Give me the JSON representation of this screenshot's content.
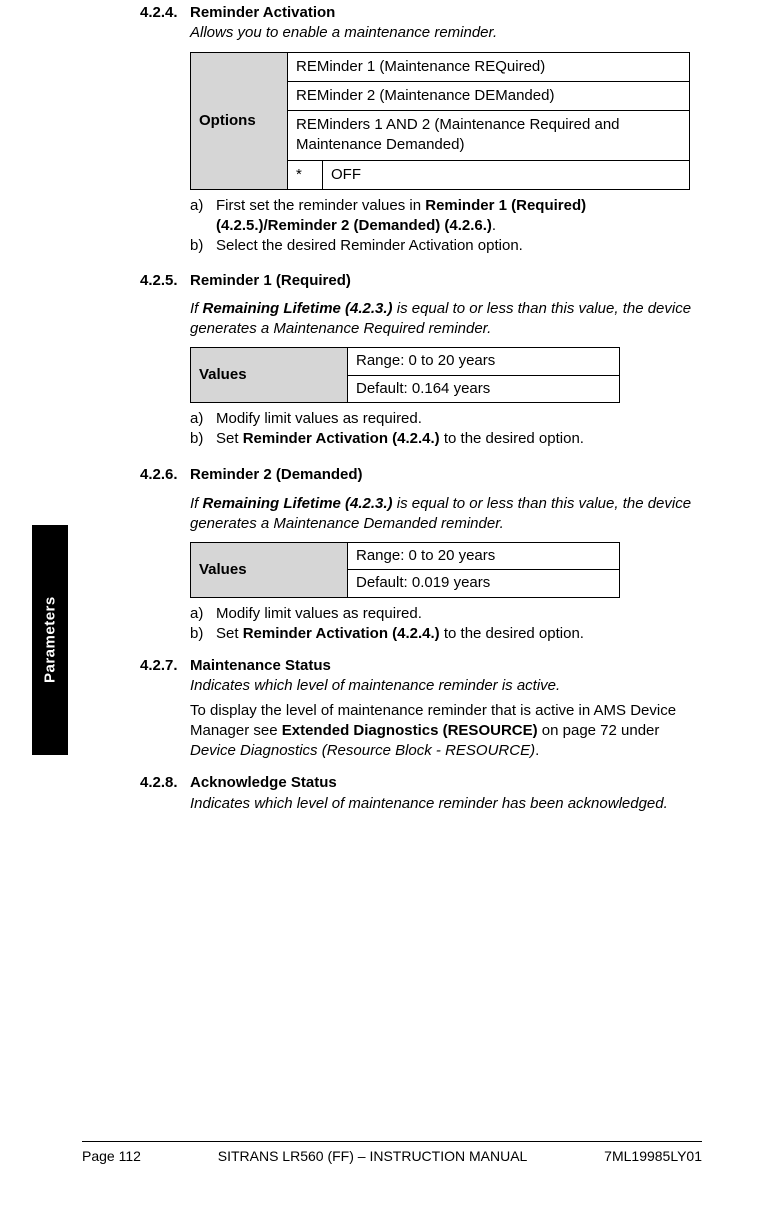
{
  "sidetab": "Parameters",
  "sections": {
    "s424": {
      "num": "4.2.4.",
      "title": "Reminder Activation",
      "desc": "Allows you to enable a maintenance reminder.",
      "optionsLabel": "Options",
      "opt1": "REMinder 1 (Maintenance REQuired)",
      "opt2": "REMinder 2 (Maintenance DEManded)",
      "opt3": "REMinders 1 AND 2 (Maintenance Required and Maintenance Demanded)",
      "star": "*",
      "opt4": "OFF",
      "a_pre": "First set the reminder values in ",
      "a_bold": "Reminder 1 (Required) (4.2.5.)/Reminder 2 (Demanded) (4.2.6.)",
      "a_post": ".",
      "b": "Select the desired Reminder Activation option."
    },
    "s425": {
      "num": "4.2.5.",
      "title": "Reminder 1 (Required)",
      "desc_pre": "If ",
      "desc_bold": "Remaining Lifetime (4.2.3.)",
      "desc_post": " is equal to or less than this value, the device generates a Maintenance Required reminder.",
      "valuesLabel": "Values",
      "range": "Range: 0 to 20 years",
      "default": "Default: 0.164 years",
      "a": "Modify limit values as required.",
      "b_pre": "Set ",
      "b_bold": "Reminder Activation (4.2.4.)",
      "b_post": " to the desired option."
    },
    "s426": {
      "num": "4.2.6.",
      "title": "Reminder 2 (Demanded)",
      "desc_pre": "If ",
      "desc_bold": "Remaining Lifetime (4.2.3.)",
      "desc_post": " is equal to or less than this value, the device generates a Maintenance Demanded reminder.",
      "valuesLabel": "Values",
      "range": "Range: 0 to 20 years",
      "default": "Default: 0.019 years",
      "a": "Modify limit values as required.",
      "b_pre": "Set ",
      "b_bold": "Reminder Activation (4.2.4.)",
      "b_post": " to the desired option."
    },
    "s427": {
      "num": "4.2.7.",
      "title": "Maintenance Status",
      "desc": "Indicates which level of maintenance reminder is active.",
      "p1_pre": "To display the level of maintenance reminder that is active in AMS Device Manager see ",
      "p1_bold": "Extended Diagnostics (RESOURCE)",
      "p1_mid": " on page 72 under ",
      "p1_ital": "Device Diagnostics (Resource Block - RESOURCE)",
      "p1_post": "."
    },
    "s428": {
      "num": "4.2.8.",
      "title": "Acknowledge Status",
      "desc": "Indicates which level of maintenance reminder has been acknowledged."
    }
  },
  "labels": {
    "la": "a)",
    "lb": "b)"
  },
  "footer": {
    "left": "Page 112",
    "center": "SITRANS LR560 (FF) – INSTRUCTION MANUAL",
    "right": "7ML19985LY01"
  }
}
